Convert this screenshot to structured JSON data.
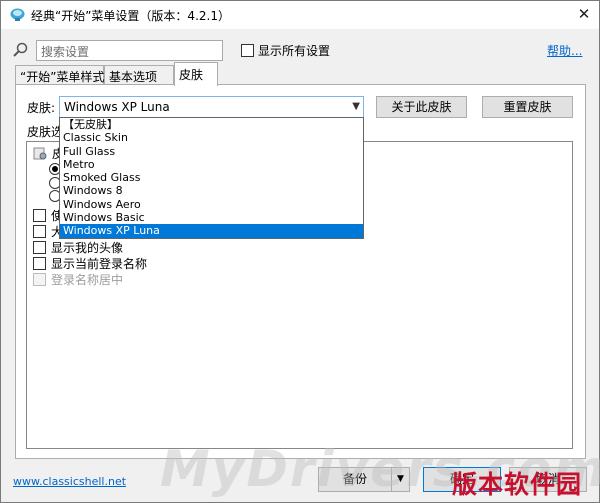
{
  "window": {
    "title": "经典“开始”菜单设置（版本：4.2.1）",
    "close_glyph": "✕"
  },
  "toolbar": {
    "search_placeholder": "搜索设置",
    "show_all_label": "显示所有设置",
    "show_all_checked": false,
    "help_label": "帮助..."
  },
  "tabs": [
    {
      "label": "“开始”菜单样式",
      "active": false
    },
    {
      "label": "基本选项",
      "active": false
    },
    {
      "label": "皮肤",
      "active": true
    }
  ],
  "skin": {
    "label": "皮肤:",
    "selected": "Windows XP Luna",
    "about_button": "关于此皮肤",
    "reset_button": "重置皮肤",
    "dropdown_options": [
      "【无皮肤】",
      "Classic Skin",
      "Full Glass",
      "Metro",
      "Smoked Glass",
      "Windows 8",
      "Windows Aero",
      "Windows Basic",
      "Windows XP Luna"
    ]
  },
  "skin_options": {
    "label_visible": "皮肤选",
    "rows": [
      {
        "kind": "gear",
        "text": "皮"
      },
      {
        "kind": "radio",
        "text": "",
        "checked": true
      },
      {
        "kind": "radio",
        "text": "",
        "checked": false
      },
      {
        "kind": "radio",
        "text": "",
        "checked": false
      },
      {
        "kind": "checkbox",
        "text": "使",
        "checked": false
      },
      {
        "kind": "checkbox",
        "text": "大",
        "checked": false
      },
      {
        "kind": "checkbox",
        "text": "显示我的头像",
        "checked": false
      },
      {
        "kind": "checkbox",
        "text": "显示当前登录名称",
        "checked": false
      },
      {
        "kind": "checkbox",
        "text": "登录名称居中",
        "checked": false,
        "disabled": true
      }
    ]
  },
  "footer": {
    "website": "www.classicshell.net",
    "backup_label": "备份",
    "ok_label": "确定",
    "cancel_label": "取消"
  },
  "watermarks": {
    "mydrivers": "MyDrivers.com",
    "site": "版本软件园"
  },
  "colors": {
    "accent": "#0078d7",
    "link": "#0066cc",
    "watermark_red": "#c8102e"
  },
  "icons": {
    "app": "classic-shell-shell-icon",
    "search": "magnifier-icon",
    "skin_settings": "gear-icon"
  }
}
